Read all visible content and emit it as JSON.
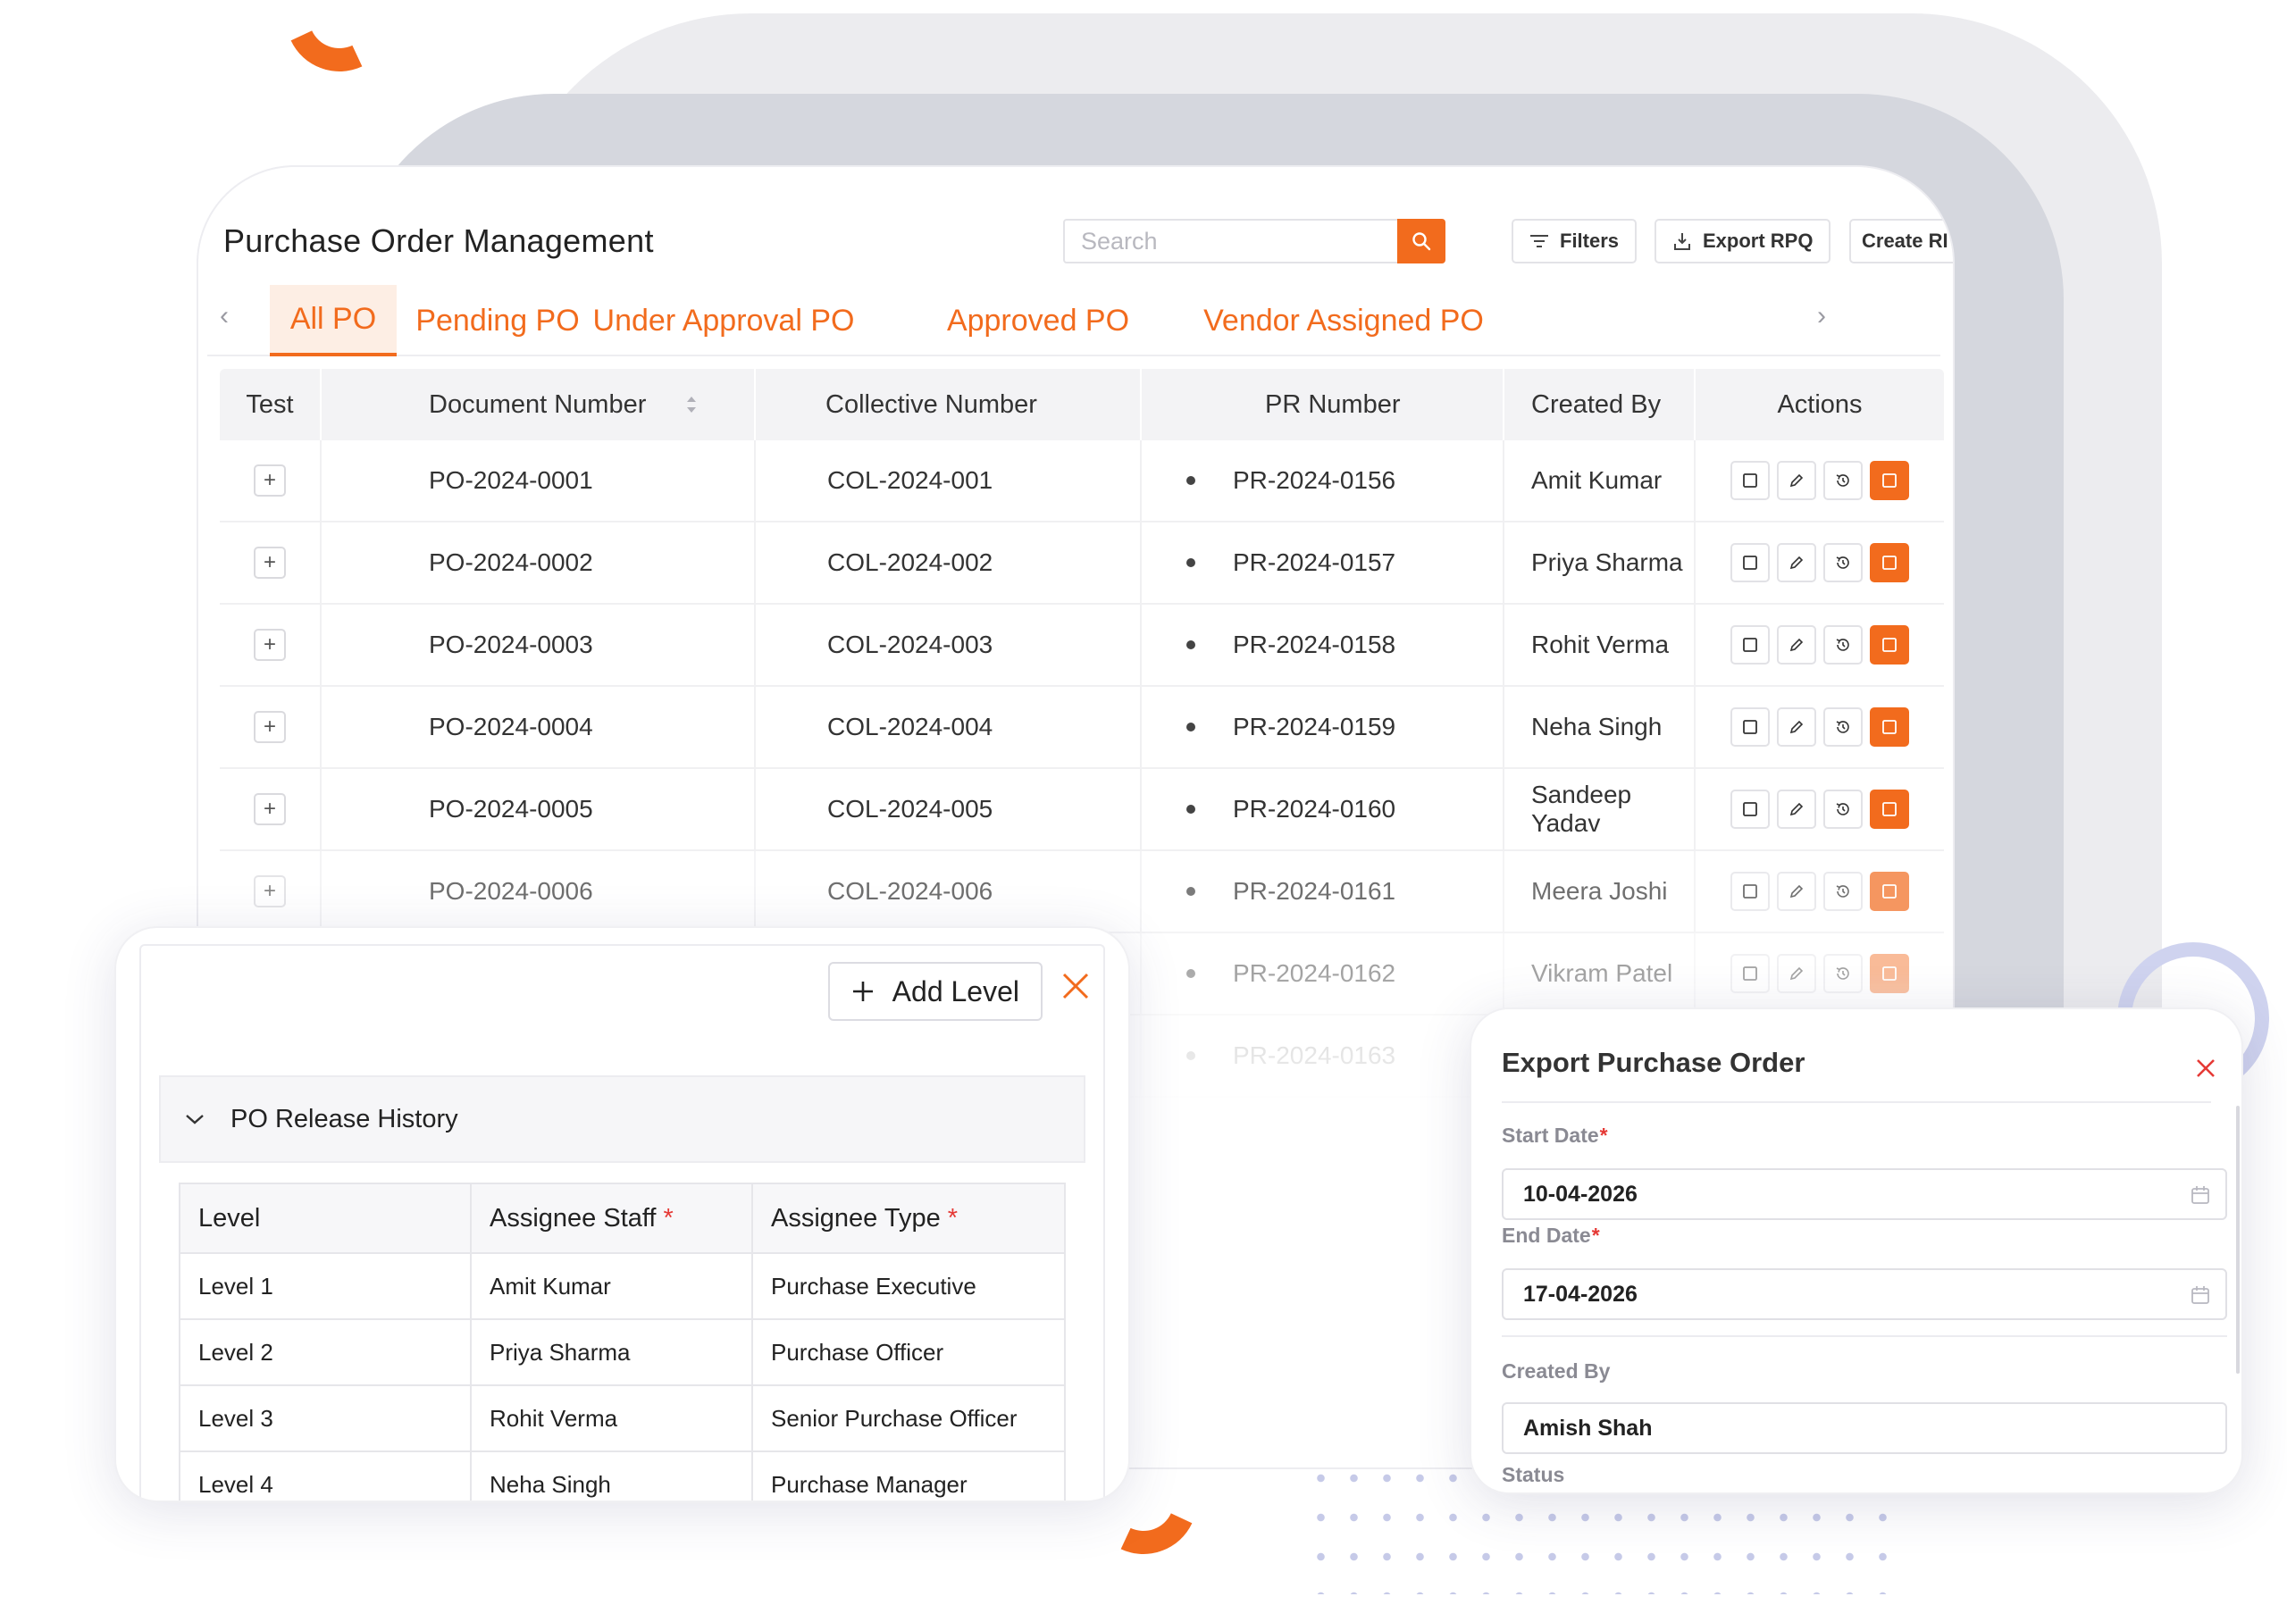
{
  "page_title": "Purchase Order Management",
  "search": {
    "placeholder": "Search"
  },
  "toolbar": {
    "filters_label": "Filters",
    "export_label": "Export RPQ",
    "create_label": "Create RI"
  },
  "tabs": [
    {
      "label": "All PO",
      "active": true
    },
    {
      "label": "Pending PO",
      "active": false
    },
    {
      "label": "Under Approval PO",
      "active": false
    },
    {
      "label": "Approved PO",
      "active": false
    },
    {
      "label": "Vendor Assigned PO",
      "active": false
    }
  ],
  "table": {
    "columns": [
      "Test",
      "Document Number",
      "Collective Number",
      "PR Number",
      "Created By",
      "Actions"
    ],
    "rows": [
      {
        "doc": "PO-2024-0001",
        "col": "COL-2024-001",
        "pr": "PR-2024-0156",
        "by": "Amit Kumar"
      },
      {
        "doc": "PO-2024-0002",
        "col": "COL-2024-002",
        "pr": "PR-2024-0157",
        "by": "Priya Sharma"
      },
      {
        "doc": "PO-2024-0003",
        "col": "COL-2024-003",
        "pr": "PR-2024-0158",
        "by": "Rohit Verma"
      },
      {
        "doc": "PO-2024-0004",
        "col": "COL-2024-004",
        "pr": "PR-2024-0159",
        "by": "Neha Singh"
      },
      {
        "doc": "PO-2024-0005",
        "col": "COL-2024-005",
        "pr": "PR-2024-0160",
        "by": "Sandeep Yadav"
      },
      {
        "doc": "PO-2024-0006",
        "col": "COL-2024-006",
        "pr": "PR-2024-0161",
        "by": "Meera Joshi"
      },
      {
        "doc": "",
        "col": "",
        "pr": "PR-2024-0162",
        "by": "Vikram Patel"
      },
      {
        "doc": "",
        "col": "",
        "pr": "PR-2024-0163",
        "by": ""
      }
    ]
  },
  "release_panel": {
    "add_level_label": "Add Level",
    "section_title": "PO Release History",
    "columns": [
      "Level",
      "Assignee Staff",
      "Assignee Type"
    ],
    "rows": [
      {
        "level": "Level 1",
        "staff": "Amit Kumar",
        "type": "Purchase Executive"
      },
      {
        "level": "Level 2",
        "staff": "Priya Sharma",
        "type": "Purchase Officer"
      },
      {
        "level": "Level 3",
        "staff": "Rohit Verma",
        "type": "Senior Purchase Officer"
      },
      {
        "level": "Level 4",
        "staff": "Neha Singh",
        "type": "Purchase Manager"
      }
    ]
  },
  "export_panel": {
    "title": "Export Purchase Order",
    "start_date_label": "Start Date",
    "start_date": "10-04-2026",
    "end_date_label": "End Date",
    "end_date": "17-04-2026",
    "created_by_label": "Created By",
    "created_by": "Amish Shah",
    "status_label": "Status"
  },
  "colors": {
    "accent": "#f26b1d",
    "required": "#e53935"
  },
  "icons": [
    "search-icon",
    "filter-icon",
    "export-icon",
    "chevron-left-icon",
    "chevron-right-icon",
    "sort-icon",
    "expand-icon",
    "view-icon",
    "edit-icon",
    "history-icon",
    "approve-icon",
    "plus-icon",
    "close-icon",
    "chevron-down-icon",
    "calendar-icon"
  ]
}
